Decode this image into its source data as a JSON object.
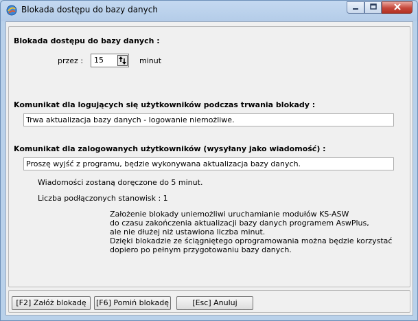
{
  "window": {
    "title": "Blokada dostępu do bazy danych"
  },
  "section_lock": {
    "heading": "Blokada dostępu do bazy danych :",
    "duration_label": "przez :",
    "duration_value": "15",
    "duration_unit": "minut"
  },
  "section_login_msg": {
    "heading": "Komunikat dla logujących się użytkowników podczas trwania blokady :",
    "value": "Trwa aktualizacja bazy danych - logowanie niemożliwe."
  },
  "section_logged_msg": {
    "heading": "Komunikat dla zalogowanych użytkowników (wysyłany jako wiadomość) :",
    "value": "Proszę wyjść z programu, będzie wykonywana aktualizacja bazy danych."
  },
  "status": {
    "delivery": "Wiadomości zostaną doręczone do 5 minut.",
    "stations": "Liczba podłączonych stanowisk : 1"
  },
  "info_lines": [
    "Założenie blokady uniemożliwi uruchamianie modułów KS-ASW",
    "do czasu zakończenia aktualizacji bazy danych programem AswPlus,",
    "ale nie dłużej niż ustawiona liczba minut.",
    "Dzięki blokadzie ze ściągniętego oprogramowania można będzie korzystać",
    "dopiero po pełnym przygotowaniu bazy danych."
  ],
  "buttons": {
    "apply": "[F2] Załóż blokadę",
    "skip": "[F6] Pomiń blokadę",
    "cancel": "[Esc] Anuluj"
  }
}
